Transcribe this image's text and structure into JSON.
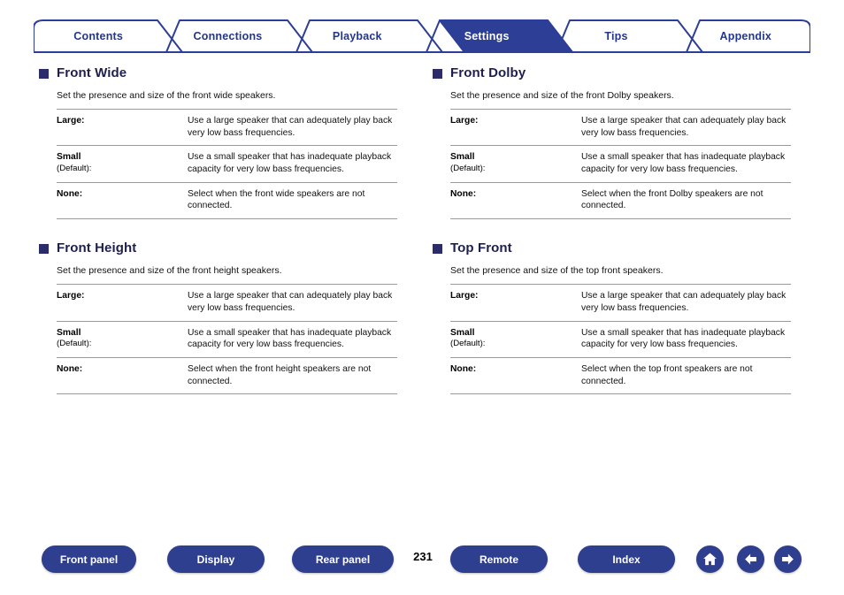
{
  "tabs": [
    {
      "label": "Contents",
      "active": false
    },
    {
      "label": "Connections",
      "active": false
    },
    {
      "label": "Playback",
      "active": false
    },
    {
      "label": "Settings",
      "active": true
    },
    {
      "label": "Tips",
      "active": false
    },
    {
      "label": "Appendix",
      "active": false
    }
  ],
  "sections": [
    {
      "title": "Front Wide",
      "description": "Set the presence and size of the front wide speakers.",
      "rows": [
        {
          "term": "Large:",
          "sub": "",
          "desc": "Use a large speaker that can adequately play back very low bass frequencies."
        },
        {
          "term": "Small",
          "sub": "(Default):",
          "desc": "Use a small speaker that has inadequate playback capacity for very low bass frequencies."
        },
        {
          "term": "None:",
          "sub": "",
          "desc": "Select when the front wide speakers are not connected."
        }
      ]
    },
    {
      "title": "Front Height",
      "description": "Set the presence and size of the front height speakers.",
      "rows": [
        {
          "term": "Large:",
          "sub": "",
          "desc": "Use a large speaker that can adequately play back very low bass frequencies."
        },
        {
          "term": "Small",
          "sub": "(Default):",
          "desc": "Use a small speaker that has inadequate playback capacity for very low bass frequencies."
        },
        {
          "term": "None:",
          "sub": "",
          "desc": "Select when the front height speakers are not connected."
        }
      ]
    },
    {
      "title": "Front Dolby",
      "description": "Set the presence and size of the front Dolby speakers.",
      "rows": [
        {
          "term": "Large:",
          "sub": "",
          "desc": "Use a large speaker that can adequately play back very low bass frequencies."
        },
        {
          "term": "Small",
          "sub": "(Default):",
          "desc": "Use a small speaker that has inadequate playback capacity for very low bass frequencies."
        },
        {
          "term": "None:",
          "sub": "",
          "desc": "Select when the front Dolby speakers are not connected."
        }
      ]
    },
    {
      "title": "Top Front",
      "description": "Set the presence and size of the top front speakers.",
      "rows": [
        {
          "term": "Large:",
          "sub": "",
          "desc": "Use a large speaker that can adequately play back very low bass frequencies."
        },
        {
          "term": "Small",
          "sub": "(Default):",
          "desc": "Use a small speaker that has inadequate playback capacity for very low bass frequencies."
        },
        {
          "term": "None:",
          "sub": "",
          "desc": "Select when the top front speakers are not connected."
        }
      ]
    }
  ],
  "footer": {
    "front_panel": "Front panel",
    "display": "Display",
    "rear_panel": "Rear panel",
    "page_number": "231",
    "remote": "Remote",
    "index": "Index",
    "home_icon": "home-icon",
    "back_icon": "arrow-left-icon",
    "forward_icon": "arrow-right-icon"
  },
  "colors": {
    "accent": "#2f3f8f",
    "tab_text": "#24368c",
    "heading": "#1f1f4f"
  }
}
